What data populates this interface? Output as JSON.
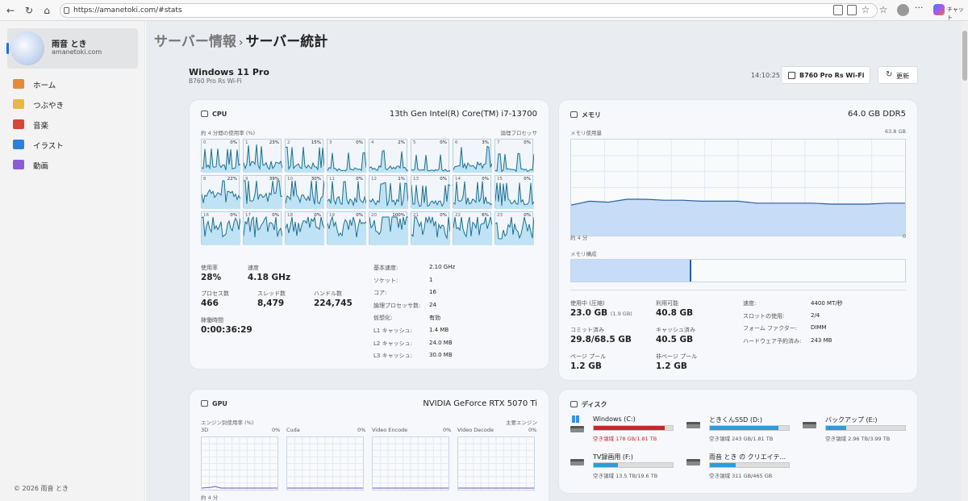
{
  "browser": {
    "url": "https://amanetoki.com/#stats",
    "chat_label": "チャット"
  },
  "sidebar": {
    "name": "雨音 とき",
    "site": "amanetoki.com",
    "items": [
      {
        "label": "ホーム",
        "icon": "home-icon",
        "color": "#e8893a"
      },
      {
        "label": "つぶやき",
        "icon": "pencil-icon",
        "color": "#e6b84a"
      },
      {
        "label": "音楽",
        "icon": "music-icon",
        "color": "#d8453b"
      },
      {
        "label": "イラスト",
        "icon": "image-icon",
        "color": "#2f7fd8"
      },
      {
        "label": "動画",
        "icon": "video-icon",
        "color": "#8b5cd6"
      }
    ],
    "copyright": "© 2026 雨音 とき"
  },
  "header": {
    "breadcrumb_parent": "サーバー情報",
    "breadcrumb_sep": "›",
    "breadcrumb_current": "サーバー統計",
    "os": "Windows 11 Pro",
    "board": "B760 Pro Rs Wi-Fi",
    "time": "14:10:25",
    "device_select": "B760 Pro Rs Wi-Fi",
    "refresh_label": "更新"
  },
  "cpu": {
    "title": "CPU",
    "model": "13th Gen Intel(R) Core(TM) i7-13700",
    "usage_caption": "約 4 分間の使用率 (%)",
    "lp_caption": "論理プロセッサ",
    "cores": [
      {
        "n": "0",
        "p": "0%",
        "level": 0.25
      },
      {
        "n": "1",
        "p": "23%",
        "level": 0.35
      },
      {
        "n": "2",
        "p": "15%",
        "level": 0.3
      },
      {
        "n": "3",
        "p": "0%",
        "level": 0.15
      },
      {
        "n": "4",
        "p": "2%",
        "level": 0.2
      },
      {
        "n": "5",
        "p": "0%",
        "level": 0.1
      },
      {
        "n": "6",
        "p": "3%",
        "level": 0.3
      },
      {
        "n": "7",
        "p": "0%",
        "level": 0.12
      },
      {
        "n": "8",
        "p": "22%",
        "level": 0.55
      },
      {
        "n": "9",
        "p": "39%",
        "level": 0.45
      },
      {
        "n": "10",
        "p": "30%",
        "level": 0.4
      },
      {
        "n": "11",
        "p": "0%",
        "level": 0.35
      },
      {
        "n": "12",
        "p": "1%",
        "level": 0.3
      },
      {
        "n": "13",
        "p": "0%",
        "level": 0.25
      },
      {
        "n": "14",
        "p": "0%",
        "level": 0.35
      },
      {
        "n": "15",
        "p": "0%",
        "level": 0.3
      },
      {
        "n": "16",
        "p": "0%",
        "level": 0.8
      },
      {
        "n": "17",
        "p": "0%",
        "level": 0.75
      },
      {
        "n": "18",
        "p": "0%",
        "level": 0.8
      },
      {
        "n": "19",
        "p": "0%",
        "level": 0.75
      },
      {
        "n": "20",
        "p": "100%",
        "level": 1.0
      },
      {
        "n": "21",
        "p": "0%",
        "level": 0.7
      },
      {
        "n": "22",
        "p": "6%",
        "level": 0.7
      },
      {
        "n": "23",
        "p": "0%",
        "level": 0.65
      }
    ],
    "stats": {
      "usage_label": "使用率",
      "usage": "28%",
      "speed_label": "速度",
      "speed": "4.18 GHz",
      "proc_label": "プロセス数",
      "proc": "466",
      "thread_label": "スレッド数",
      "thread": "8,479",
      "handle_label": "ハンドル数",
      "handle": "224,745",
      "uptime_label": "稼働時間",
      "uptime": "0:00:36:29"
    },
    "info": [
      {
        "k": "基本速度:",
        "v": "2.10 GHz"
      },
      {
        "k": "ソケット:",
        "v": "1"
      },
      {
        "k": "コア:",
        "v": "16"
      },
      {
        "k": "論理プロセッサ数:",
        "v": "24"
      },
      {
        "k": "仮想化:",
        "v": "有効"
      },
      {
        "k": "L1 キャッシュ:",
        "v": "1.4 MB"
      },
      {
        "k": "L2 キャッシュ:",
        "v": "24.0 MB"
      },
      {
        "k": "L3 キャッシュ:",
        "v": "30.0 MB"
      }
    ]
  },
  "memory": {
    "title": "メモリ",
    "model": "64.0 GB DDR5",
    "usage_caption": "メモリ使用量",
    "max": "63.8 GB",
    "x_left": "約 4 分",
    "x_right": "0",
    "usage_level": 0.36,
    "composition_caption": "メモリ構成",
    "composition_used_fraction": 0.36,
    "stats": {
      "inuse_label": "使用中 (圧縮)",
      "inuse": "23.0 GB",
      "inuse_sub": "(1.9 GB)",
      "avail_label": "利用可能",
      "avail": "40.8 GB",
      "commit_label": "コミット済み",
      "commit": "29.8/68.5 GB",
      "cached_label": "キャッシュ済み",
      "cached": "40.5 GB",
      "paged_label": "ページ プール",
      "paged": "1.2 GB",
      "nonpaged_label": "非ページ プール",
      "nonpaged": "1.2 GB"
    },
    "info": [
      {
        "k": "速度:",
        "v": "4400 MT/秒"
      },
      {
        "k": "スロットの使用:",
        "v": "2/4"
      },
      {
        "k": "フォーム ファクター:",
        "v": "DIMM"
      },
      {
        "k": "ハードウェア予約済み:",
        "v": "243 MB"
      }
    ]
  },
  "gpu": {
    "title": "GPU",
    "model": "NVIDIA GeForce RTX 5070 Ti",
    "caption": "エンジン別使用率 (%)",
    "main_engine": "主要エンジン",
    "x_left": "約 4 分",
    "engines": [
      {
        "label": "3D",
        "p": "0%"
      },
      {
        "label": "Cuda",
        "p": "0%"
      },
      {
        "label": "Video Encode",
        "p": "0%"
      },
      {
        "label": "Video Decode",
        "p": "0%"
      }
    ]
  },
  "disk": {
    "title": "ディスク",
    "drives": [
      {
        "name": "Windows (C:)",
        "free": "空き領域 178 GB/1.81 TB",
        "fraction": 0.9,
        "color": "#c8262b",
        "free_color": "#c8262b"
      },
      {
        "name": "ときくんSSD (D:)",
        "free": "空き領域 243 GB/1.81 TB",
        "fraction": 0.87,
        "color": "#2f9bd9",
        "free_color": "#555555"
      },
      {
        "name": "バックアップ (E:)",
        "free": "空き領域 2.96 TB/3.99 TB",
        "fraction": 0.26,
        "color": "#2f9bd9",
        "free_color": "#555555"
      },
      {
        "name": "TV録画用 (F:)",
        "free": "空き領域 13.5 TB/19.6 TB",
        "fraction": 0.31,
        "color": "#2f9bd9",
        "free_color": "#555555"
      },
      {
        "name": "雨音 とき の クリエイテ...",
        "free": "空き領域 311 GB/465 GB",
        "fraction": 0.33,
        "color": "#2f9bd9",
        "free_color": "#555555"
      }
    ]
  }
}
